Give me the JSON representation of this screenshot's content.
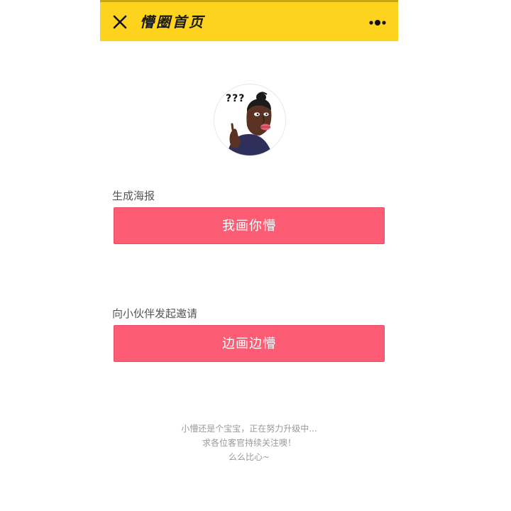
{
  "header": {
    "title": "懵圈首页",
    "close_icon": "close-icon",
    "more_icon": "more-dots-icon",
    "background": "#fdd31d"
  },
  "avatar": {
    "caption": "???"
  },
  "sections": [
    {
      "label": "生成海报",
      "button": "我画你懵"
    },
    {
      "label": "向小伙伴发起邀请",
      "button": "边画边懵"
    }
  ],
  "accent": "#fc5d74",
  "footer": {
    "line1": "小懵还是个宝宝，正在努力升级中...",
    "line2": "求各位客官持续关注噢！",
    "line3": "么么比心~"
  }
}
